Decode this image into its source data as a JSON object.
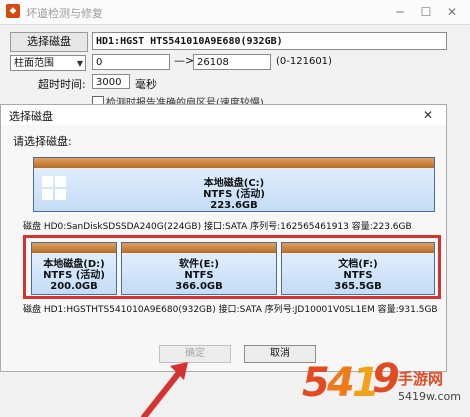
{
  "background_window": {
    "title": "坏道检测与修复",
    "minimize_glyph": "─",
    "maximize_glyph": "☐",
    "close_glyph": "✕",
    "select_disk_button": "选择磁盘",
    "disk_display": "HD1:HGST HTS541010A9E680(932GB)",
    "range_mode": "柱面范围",
    "range_start": "0",
    "range_separator": "—>",
    "range_end": "26108",
    "range_hint": "(0-121601)",
    "timeout_label": "超时时间:",
    "timeout_value": "3000",
    "timeout_unit": "毫秒",
    "checkbox_label": "检测时报告准确的扇区号(速度较慢)"
  },
  "dialog": {
    "title": "选择磁盘",
    "close_glyph": "✕",
    "prompt": "请选择磁盘:",
    "disks": [
      {
        "info": "磁盘 HD0:SanDiskSDSSDA240G(224GB)    接口:SATA  序列号:162565461913  容量:223.6GB",
        "volumes": [
          {
            "name": "本地磁盘(C:)",
            "fs": "NTFS (活动)",
            "size": "223.6GB"
          }
        ]
      },
      {
        "info": "磁盘 HD1:HGSTHTS541010A9E680(932GB)    接口:SATA  序列号:JD10001V0SL1EM   容量:931.5GB",
        "volumes": [
          {
            "name": "本地磁盘(D:)",
            "fs": "NTFS (活动)",
            "size": "200.0GB"
          },
          {
            "name": "软件(E:)",
            "fs": "NTFS",
            "size": "366.0GB"
          },
          {
            "name": "文档(F:)",
            "fs": "NTFS",
            "size": "365.5GB"
          }
        ]
      }
    ],
    "ok_button": "确定",
    "cancel_button": "取消"
  },
  "watermark": {
    "chars": [
      "5",
      "4",
      "1",
      "9"
    ],
    "site": "手游网",
    "domain": "5419w.com"
  },
  "colors": {
    "volume_bar": "#b86c22",
    "volume_fill": "#c4dcf6",
    "highlight": "#d63232"
  }
}
